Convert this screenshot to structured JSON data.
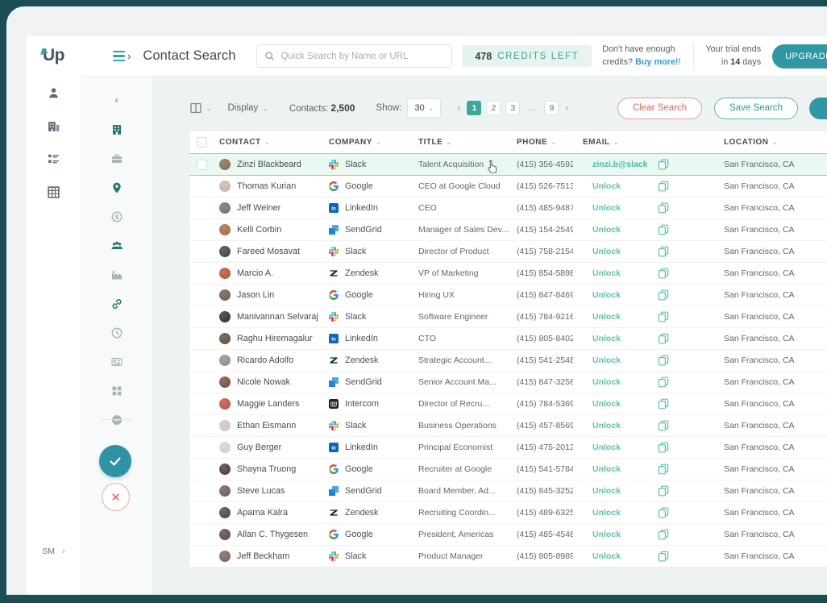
{
  "colors": {
    "frame": "#174f55",
    "accent_teal": "#2ba79b",
    "accent_blue_teal": "#2e98a6",
    "pagination_active": "#3ba79e",
    "unlock_link": "#56c4ae",
    "email_link": "#41bfa0",
    "danger_red": "#e4655c",
    "buy_more_blue": "#2b9fd9",
    "selected_row_bg": "#e9f8f1",
    "selected_row_border": "#86d7bf"
  },
  "topbar": {
    "logo": "Up",
    "title": "Contact Search",
    "search_placeholder": "Quick Search by Name or URL",
    "credits": {
      "count": "478",
      "label": "CREDITS LEFT"
    },
    "buy_more": {
      "line1": "Don't have enough",
      "line2": "credits?",
      "link": "Buy more!"
    },
    "trial": {
      "line1": "Your trial ends",
      "prefix": "in",
      "days": "14",
      "suffix": "days"
    },
    "upgrade_label": "UPGRADE"
  },
  "sidebar": {
    "items": [
      {
        "icon": "person"
      },
      {
        "icon": "buildings"
      },
      {
        "icon": "list"
      },
      {
        "icon": "table"
      }
    ],
    "user_initials": "SM",
    "expand_icon": "›"
  },
  "filter_panel": {
    "collapse_icon": "‹",
    "items": [
      {
        "icon": "building",
        "active": true
      },
      {
        "icon": "briefcase",
        "active": false
      },
      {
        "icon": "pin",
        "active": true
      },
      {
        "icon": "dollar",
        "active": false
      },
      {
        "icon": "people",
        "active": true
      },
      {
        "icon": "factory",
        "active": false
      },
      {
        "icon": "link",
        "active": true
      },
      {
        "icon": "clock",
        "active": false
      },
      {
        "icon": "card",
        "active": false
      },
      {
        "icon": "grid",
        "active": false
      },
      {
        "icon": "minus",
        "active": false
      }
    ]
  },
  "toolbar": {
    "display_label": "Display",
    "contacts_label": "Contacts:",
    "contacts_value": "2,500",
    "show_label": "Show:",
    "show_value": "30",
    "pagination": {
      "prev": "‹",
      "pages": [
        "1",
        "2",
        "3",
        "...",
        "9"
      ],
      "active": "1",
      "next": "›"
    },
    "clear_label": "Clear Search",
    "save_label": "Save Search"
  },
  "table": {
    "sort_icon": "⌄",
    "headers": [
      "CONTACT",
      "COMPANY",
      "TITLE",
      "PHONE",
      "EMAIL",
      "LOCATION"
    ],
    "rows": [
      {
        "name": "Zinzi Blackbeard",
        "company": "Slack",
        "title": "Talent Acquisition",
        "phone": "(415) 356-4592",
        "email": "zinzi.b@slack.com",
        "email_unlocked": true,
        "location": "San Francisco, CA",
        "selected": true
      },
      {
        "name": "Thomas Kurian",
        "company": "Google",
        "title": "CEO at Google Cloud",
        "phone": "(415) 526-7513",
        "email": "Unlock",
        "email_unlocked": false,
        "location": "San Francisco, CA",
        "selected": false
      },
      {
        "name": "Jeff Weiner",
        "company": "LinkedIn",
        "title": "CEO",
        "phone": "(415) 485-9487",
        "email": "Unlock",
        "email_unlocked": false,
        "location": "San Francisco, CA",
        "selected": false
      },
      {
        "name": "Kelli Corbin",
        "company": "SendGrid",
        "title": "Manager of Sales Dev...",
        "phone": "(415) 154-2549",
        "email": "Unlock",
        "email_unlocked": false,
        "location": "San Francisco, CA",
        "selected": false
      },
      {
        "name": "Fareed Mosavat",
        "company": "Slack",
        "title": "Director of Product",
        "phone": "(415) 758-2154",
        "email": "Unlock",
        "email_unlocked": false,
        "location": "San Francisco, CA",
        "selected": false
      },
      {
        "name": "Marcio A.",
        "company": "Zendesk",
        "title": "VP of Marketing",
        "phone": "(415) 854-5898",
        "email": "Unlock",
        "email_unlocked": false,
        "location": "San Francisco, CA",
        "selected": false
      },
      {
        "name": "Jason Lin",
        "company": "Google",
        "title": "Hiring UX",
        "phone": "(415) 847-8469",
        "email": "Unlock",
        "email_unlocked": false,
        "location": "San Francisco, CA",
        "selected": false
      },
      {
        "name": "Manivannan Selvaraj",
        "company": "Slack",
        "title": "Software Engineer",
        "phone": "(415) 784-9216",
        "email": "Unlock",
        "email_unlocked": false,
        "location": "San Francisco, CA",
        "selected": false
      },
      {
        "name": "Raghu Hiremagalur",
        "company": "LinkedIn",
        "title": "CTO",
        "phone": "(415) 805-8402",
        "email": "Unlock",
        "email_unlocked": false,
        "location": "San Francisco, CA",
        "selected": false
      },
      {
        "name": "Ricardo Adolfo",
        "company": "Zendesk",
        "title": "Strategic Account...",
        "phone": "(415) 541-2548",
        "email": "Unlock",
        "email_unlocked": false,
        "location": "San Francisco, CA",
        "selected": false
      },
      {
        "name": "Nicole Nowak",
        "company": "SendGrid",
        "title": "Senior Account Ma...",
        "phone": "(415) 847-3256",
        "email": "Unlock",
        "email_unlocked": false,
        "location": "San Francisco, CA",
        "selected": false
      },
      {
        "name": "Maggie Landers",
        "company": "Intercom",
        "title": "Director of Recru...",
        "phone": "(415) 784-5369",
        "email": "Unlock",
        "email_unlocked": false,
        "location": "San Francisco, CA",
        "selected": false
      },
      {
        "name": "Ethan Eismann",
        "company": "Slack",
        "title": "Business Operations",
        "phone": "(415) 457-8569",
        "email": "Unlock",
        "email_unlocked": false,
        "location": "San Francisco, CA",
        "selected": false
      },
      {
        "name": "Guy Berger",
        "company": "LinkedIn",
        "title": "Principal Economist",
        "phone": "(415) 475-2013",
        "email": "Unlock",
        "email_unlocked": false,
        "location": "San Francisco, CA",
        "selected": false
      },
      {
        "name": "Shayna Truong",
        "company": "Google",
        "title": "Recruiter at Google",
        "phone": "(415) 541-5784",
        "email": "Unlock",
        "email_unlocked": false,
        "location": "San Francisco, CA",
        "selected": false
      },
      {
        "name": "Steve Lucas",
        "company": "SendGrid",
        "title": "Board Member, Ad...",
        "phone": "(415) 845-3252",
        "email": "Unlock",
        "email_unlocked": false,
        "location": "San Francisco, CA",
        "selected": false
      },
      {
        "name": "Aparna Kalra",
        "company": "Zendesk",
        "title": "Recruiting Coordin...",
        "phone": "(415) 489-6325",
        "email": "Unlock",
        "email_unlocked": false,
        "location": "San Francisco, CA",
        "selected": false
      },
      {
        "name": "Allan C. Thygesen",
        "company": "Google",
        "title": "President, Americas",
        "phone": "(415) 485-4548",
        "email": "Unlock",
        "email_unlocked": false,
        "location": "San Francisco, CA",
        "selected": false
      },
      {
        "name": "Jeff Beckham",
        "company": "Slack",
        "title": "Product Manager",
        "phone": "(415) 805-8989",
        "email": "Unlock",
        "email_unlocked": false,
        "location": "San Francisco, CA",
        "selected": false
      }
    ]
  }
}
